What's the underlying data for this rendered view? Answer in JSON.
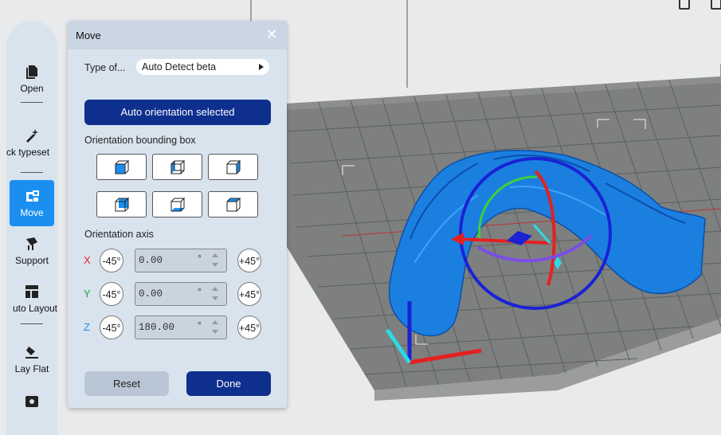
{
  "toolbar": {
    "items": [
      {
        "label": "Open",
        "icon": "file-icon"
      },
      {
        "label": "ck typeset",
        "icon": "magic-wand-icon"
      },
      {
        "label": "Move",
        "icon": "move-icon",
        "active": true
      },
      {
        "label": "Support",
        "icon": "support-icon"
      },
      {
        "label": "uto Layout",
        "icon": "layout-icon"
      },
      {
        "label": "Lay Flat",
        "icon": "lay-flat-icon"
      }
    ]
  },
  "panel": {
    "title": "Move",
    "type_label": "Type of...",
    "type_value": "Auto Detect beta",
    "auto_button": "Auto orientation selected",
    "bbox_label": "Orientation bounding box",
    "axis_label": "Orientation axis",
    "axes": [
      {
        "name": "X",
        "color": "#e0242a",
        "minus": "-45°",
        "value": "0.00",
        "unit": "°",
        "plus": "+45°"
      },
      {
        "name": "Y",
        "color": "#1aa03a",
        "minus": "-45°",
        "value": "0.00",
        "unit": "°",
        "plus": "+45°"
      },
      {
        "name": "Z",
        "color": "#1a8ff0",
        "minus": "-45°",
        "value": "180.00",
        "unit": "°",
        "plus": "+45°"
      }
    ],
    "reset": "Reset",
    "done": "Done"
  },
  "colors": {
    "accent": "#0e2f8e",
    "active_tool": "#1a8ff0",
    "model": "#1b7fe0"
  }
}
